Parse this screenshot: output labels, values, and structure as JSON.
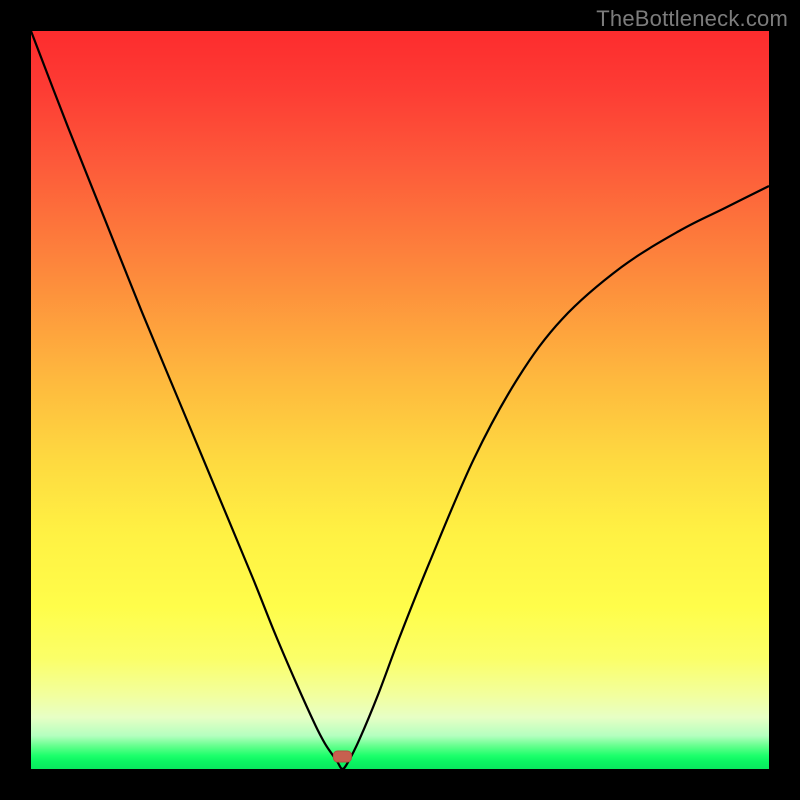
{
  "watermark": "TheBottleneck.com",
  "marker": {
    "x_frac": 0.422,
    "y_frac": 0.983
  },
  "chart_data": {
    "type": "line",
    "title": "",
    "xlabel": "",
    "ylabel": "",
    "xlim": [
      0,
      1
    ],
    "ylim": [
      0,
      1
    ],
    "series": [
      {
        "name": "curve",
        "x": [
          0.0,
          0.05,
          0.1,
          0.15,
          0.2,
          0.25,
          0.3,
          0.33,
          0.36,
          0.385,
          0.398,
          0.408,
          0.415,
          0.422,
          0.43,
          0.445,
          0.47,
          0.5,
          0.54,
          0.6,
          0.66,
          0.72,
          0.8,
          0.88,
          0.94,
          1.0
        ],
        "y": [
          1.0,
          0.87,
          0.745,
          0.62,
          0.5,
          0.38,
          0.26,
          0.185,
          0.115,
          0.06,
          0.035,
          0.02,
          0.01,
          0.0,
          0.01,
          0.04,
          0.1,
          0.18,
          0.28,
          0.42,
          0.53,
          0.61,
          0.68,
          0.73,
          0.76,
          0.79
        ]
      }
    ],
    "marker_point": {
      "x": 0.422,
      "y": 0.017
    },
    "background_gradient": {
      "top_color": "#fd2c2e",
      "mid_color": "#fff143",
      "bottom_color": "#09e85e"
    }
  }
}
